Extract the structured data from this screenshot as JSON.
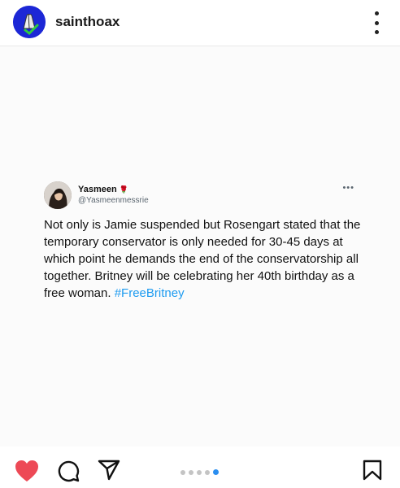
{
  "header": {
    "username": "sainthoax",
    "avatar_icon": "praying-hands-icon",
    "menu_icon": "kebab-menu-icon"
  },
  "tweet": {
    "display_name": "Yasmeen",
    "name_emoji": "🌹",
    "handle": "@Yasmeenmessrie",
    "more_icon": "more-horizontal-icon",
    "text": "Not only is Jamie suspended but Rosengart stated that the temporary conservator is only needed for 30-45 days at which point he demands the end of the conservatorship all together. Britney will be celebrating her 40th birthday as a free woman. ",
    "hashtag": "#FreeBritney"
  },
  "actions": {
    "like_icon": "heart-icon",
    "comment_icon": "comment-icon",
    "share_icon": "send-icon",
    "save_icon": "bookmark-icon",
    "carousel_total": 5,
    "carousel_active": 5
  },
  "colors": {
    "like_red": "#ed4956",
    "hashtag_blue": "#1d9bf0",
    "carousel_active": "#2b8ef0",
    "avatar_blue": "#1c27d6"
  }
}
